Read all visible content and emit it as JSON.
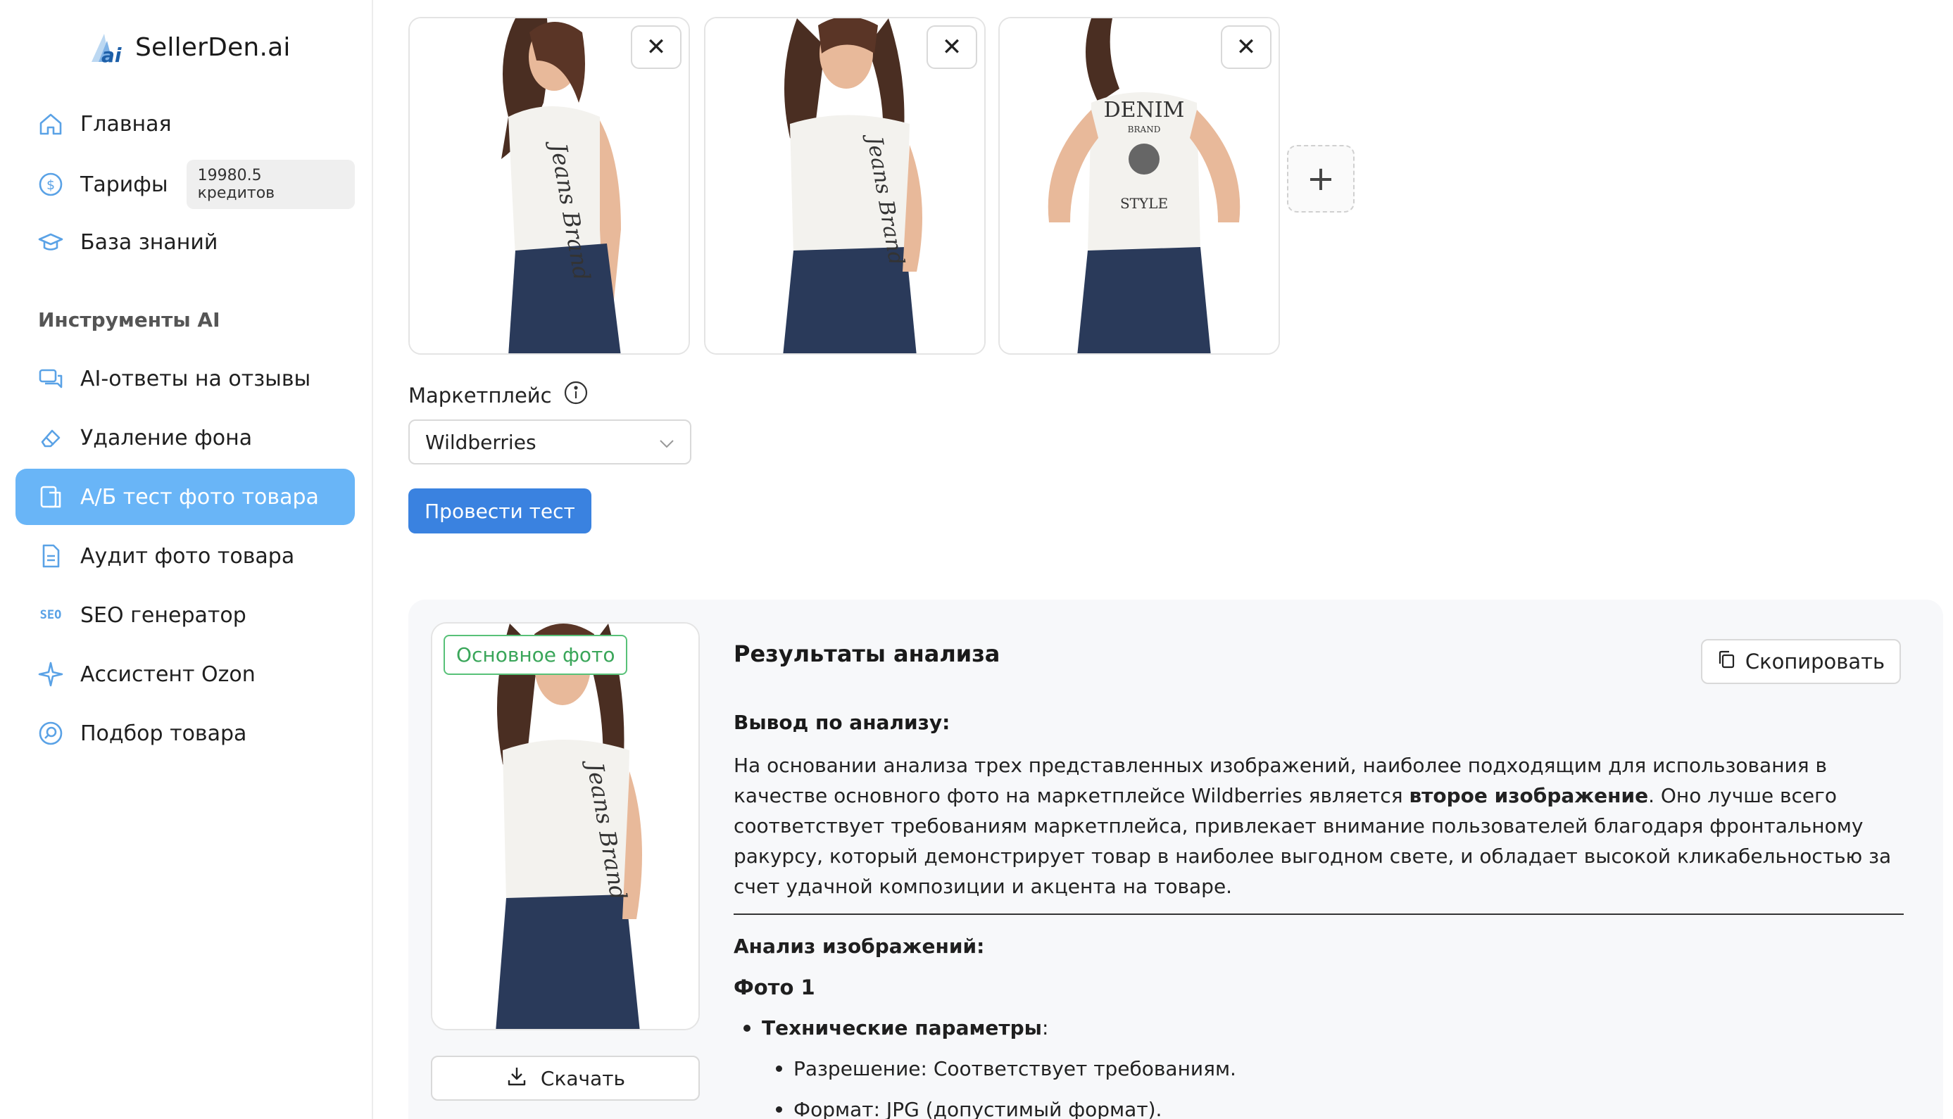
{
  "app": {
    "logo_text": "SellerDen.ai"
  },
  "sidebar": {
    "items": [
      {
        "label": "Главная",
        "icon": "home-icon"
      },
      {
        "label": "Тарифы",
        "icon": "dollar-icon",
        "badge": "19980.5 кредитов"
      },
      {
        "label": "База знаний",
        "icon": "graduation-cap-icon"
      }
    ],
    "section_title": "Инструменты AI",
    "tools": [
      {
        "label": "AI-ответы на отзывы",
        "icon": "chat-icon"
      },
      {
        "label": "Удаление фона",
        "icon": "eraser-icon"
      },
      {
        "label": "А/Б тест фото товара",
        "icon": "ab-test-icon",
        "active": true
      },
      {
        "label": "Аудит фото товара",
        "icon": "document-icon"
      },
      {
        "label": "SEO генератор",
        "icon": "seo-icon",
        "icon_text": "SEO"
      },
      {
        "label": "Ассистент Ozon",
        "icon": "sparkle-icon"
      },
      {
        "label": "Подбор товара",
        "icon": "search-circle-icon"
      }
    ]
  },
  "upload": {
    "close_symbol": "✕",
    "add_symbol": "+"
  },
  "form": {
    "marketplace_label": "Маркетплейс",
    "marketplace_value": "Wildberries",
    "run_button": "Провести тест"
  },
  "results": {
    "badge": "Основное фото",
    "download_button": "Скачать",
    "copy_button": "Скопировать",
    "title": "Результаты анализа",
    "conclusion_title": "Вывод по анализу:",
    "conclusion_part1": "На основании анализа трех представленных изображений, наиболее подходящим для использования в качестве основного фото на маркетплейсе Wildberries является ",
    "conclusion_bold": "второе изображение",
    "conclusion_part2": ". Оно лучше всего соответствует требованиям маркетплейса, привлекает внимание пользователей благодаря фронтальному ракурсу, который демонстрирует товар в наиболее выгодном свете, и обладает высокой кликабельностью за счет удачной композиции и акцента на товаре.",
    "analysis_title": "Анализ изображений:",
    "photo_title": "Фото 1",
    "tech_params_label": "Технические параметры",
    "tech_params_colon": ":",
    "params": [
      "Разрешение: Соответствует требованиям.",
      "Формат: JPG (допустимый формат)."
    ]
  },
  "colors": {
    "accent": "#3a82e0",
    "active_nav": "#69b5f7",
    "badge_green": "#3aa65a"
  }
}
